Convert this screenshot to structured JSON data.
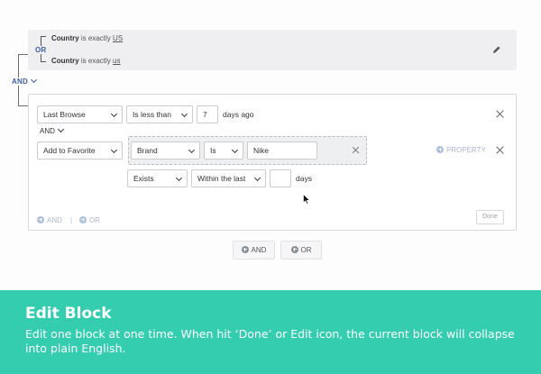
{
  "collapsed_block": {
    "or_label": "OR",
    "line1": {
      "field": "Country",
      "op": "is exactly",
      "value": "US"
    },
    "line2": {
      "field": "Country",
      "op": "is exactly",
      "value": "us"
    }
  },
  "and_label": "AND",
  "edit_block": {
    "row1": {
      "event": "Last Browse",
      "operator": "Is less than",
      "value": "7",
      "unit": "days ago"
    },
    "inner_and": "AND",
    "row2": {
      "event": "Add to Favorite",
      "property": "Brand",
      "property_op": "Is",
      "property_value": "Nike",
      "add_property": "PROPERTY"
    },
    "row3": {
      "condition": "Exists",
      "range": "Within the last",
      "value": "",
      "unit": "days"
    },
    "footer": {
      "and": "AND",
      "separator": "|",
      "or": "OR",
      "done": "Done"
    }
  },
  "bottom_buttons": {
    "and": "AND",
    "or": "OR"
  },
  "banner": {
    "title": "Edit Block",
    "text": "Edit one block at one time. When hit ‘Done’ or Edit icon, the current block will collapse into plain English."
  },
  "colors": {
    "banner": "#35cdb0",
    "logic": "#3f5fa3"
  }
}
